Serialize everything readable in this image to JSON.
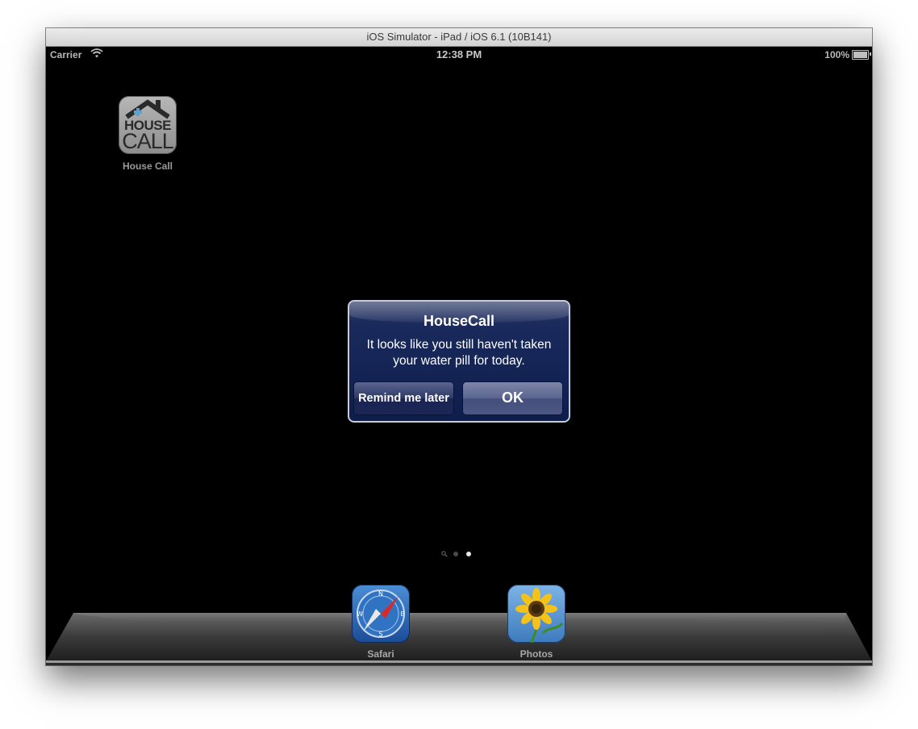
{
  "window": {
    "title": "iOS Simulator - iPad / iOS 6.1 (10B141)"
  },
  "status_bar": {
    "carrier": "Carrier",
    "time": "12:38 PM",
    "battery_percent": "100%",
    "battery_level": 1.0,
    "wifi_icon": "wifi-icon",
    "battery_icon": "battery-icon"
  },
  "home": {
    "apps": [
      {
        "label": "House Call",
        "icon": "housecall-app-icon",
        "icon_text_top": "HOUSE",
        "icon_text_bottom": "CALL"
      }
    ],
    "page_indicator": {
      "pages": 2,
      "current_page": 2,
      "search_icon": "search-icon"
    },
    "dock": [
      {
        "label": "Safari",
        "icon": "safari-compass-icon"
      },
      {
        "label": "Photos",
        "icon": "sunflower-icon"
      }
    ]
  },
  "alert": {
    "title": "HouseCall",
    "message": "It looks like you still haven't taken your water pill for today.",
    "buttons": {
      "remind": "Remind me later",
      "ok": "OK"
    }
  },
  "colors": {
    "alert_bg": "#0d1d4c",
    "alert_border": "#c5cbdb",
    "screen_bg": "#000000"
  }
}
